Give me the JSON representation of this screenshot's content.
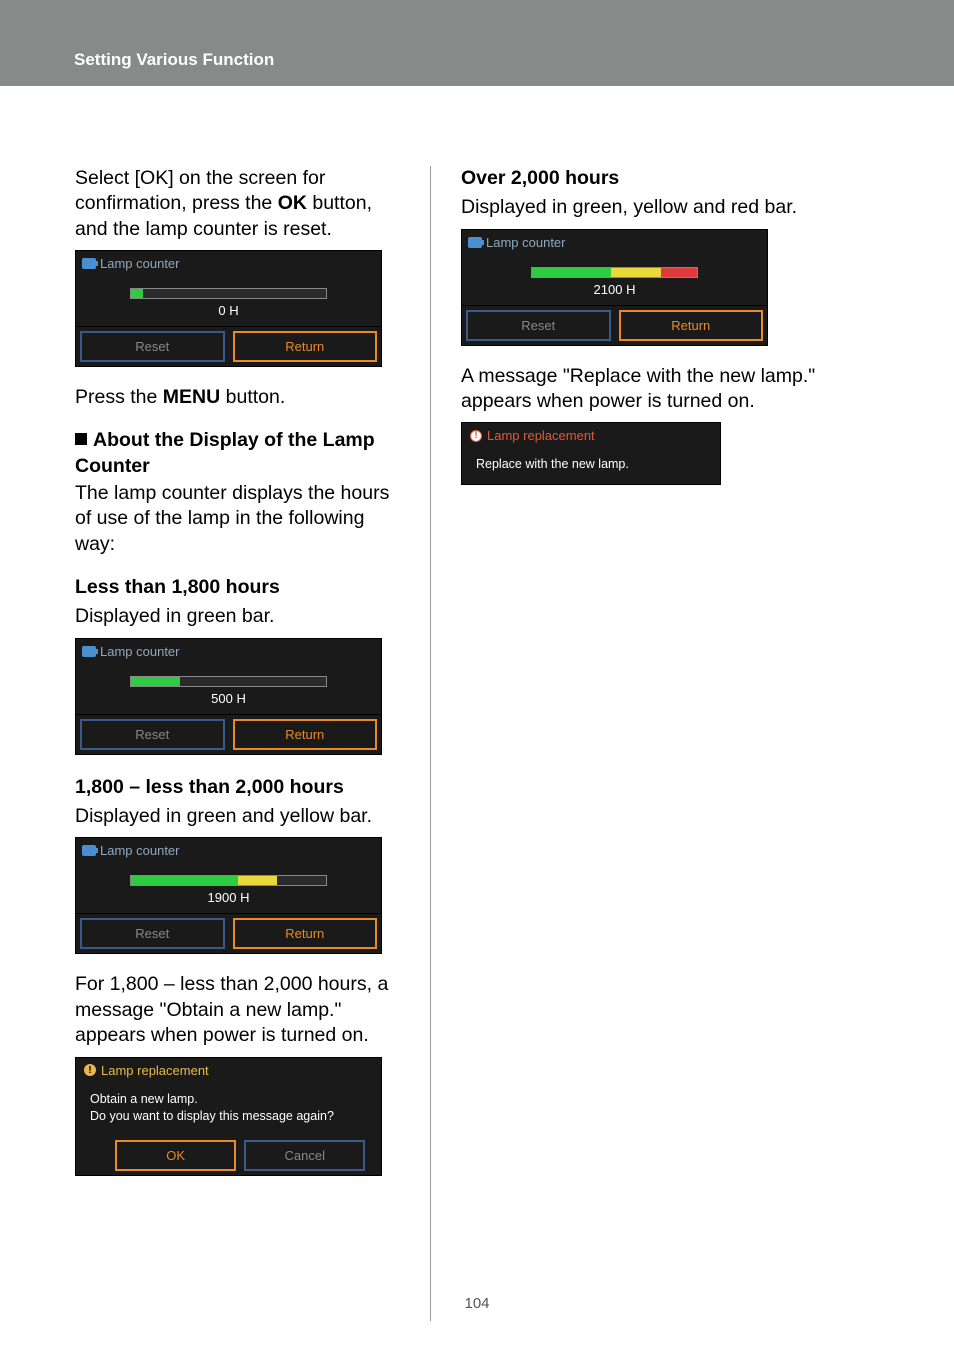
{
  "header": {
    "title": "Setting Various Function"
  },
  "left": {
    "intro1": "Select [OK] on the screen for confirmation, press the ",
    "intro_ok": "OK",
    "intro2": " button, and the lamp counter is reset.",
    "press_menu_1": "Press the ",
    "press_menu_key": "MENU",
    "press_menu_2": " button.",
    "about_heading": "About the Display of the Lamp Counter",
    "about_text": "The lamp counter displays the hours of use of the lamp in the following way:",
    "range1_title": "Less than 1,800 hours",
    "range1_sub": "Displayed in green bar.",
    "range2_title": "1,800 – less than 2,000 hours",
    "range2_sub": "Displayed in green and yellow bar.",
    "range2_note": "For 1,800 – less than 2,000 hours, a message \"Obtain a new lamp.\" appears when power is turned on."
  },
  "right": {
    "range3_title": "Over 2,000 hours",
    "range3_sub": "Displayed in green, yellow and red bar.",
    "range3_note": "A message \"Replace with the new lamp.\" appears when power is turned on."
  },
  "osd": {
    "title": "Lamp counter",
    "reset": "Reset",
    "return": "Return",
    "h0": "0 H",
    "h500": "500 H",
    "h1900": "1900 H",
    "h2100": "2100 H"
  },
  "dialog1": {
    "title": "Lamp replacement",
    "line1": "Obtain a new lamp.",
    "line2": "Do you want to display this message again?",
    "ok": "OK",
    "cancel": "Cancel"
  },
  "dialog2": {
    "title": "Lamp replacement",
    "line1": "Replace with the new lamp."
  },
  "page_number": "104"
}
